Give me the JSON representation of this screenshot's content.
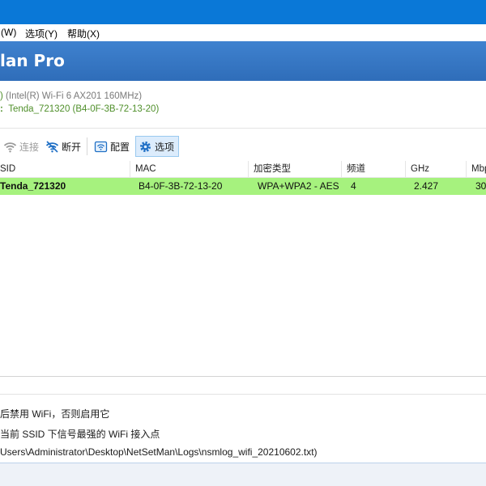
{
  "menu": {
    "window": "(W)",
    "options": "选项(Y)",
    "help": "帮助(X)"
  },
  "app": {
    "title": "lan Pro"
  },
  "info": {
    "adapter": "(Intel(R) Wi-Fi 6 AX201 160MHz)",
    "connection_prefix": ":",
    "connection": "Tenda_721320  (B4-0F-3B-72-13-20)"
  },
  "toolbar": {
    "connect": "连接",
    "disconnect": "断开",
    "profile": "配置",
    "options": "选项"
  },
  "table": {
    "headers": [
      "SID",
      "MAC",
      "加密类型",
      "频道",
      "GHz",
      "Mbp"
    ],
    "rows": [
      [
        "Tenda_721320",
        "B4-0F-3B-72-13-20",
        "WPA+WPA2 - AES",
        "4",
        "2.427",
        "30"
      ]
    ]
  },
  "log": {
    "line1": "后禁用 WiFi，否则启用它",
    "line2": "当前 SSID 下信号最强的 WiFi 接入点",
    "line3": "Users\\Administrator\\Desktop\\NetSetMan\\Logs\\nsmlog_wifi_20210602.txt)"
  },
  "colors": {
    "titlebar": "#0a78d7",
    "banner": "#3577c4",
    "active_row": "#a6f27e",
    "accent_text": "#4f8f2a"
  }
}
